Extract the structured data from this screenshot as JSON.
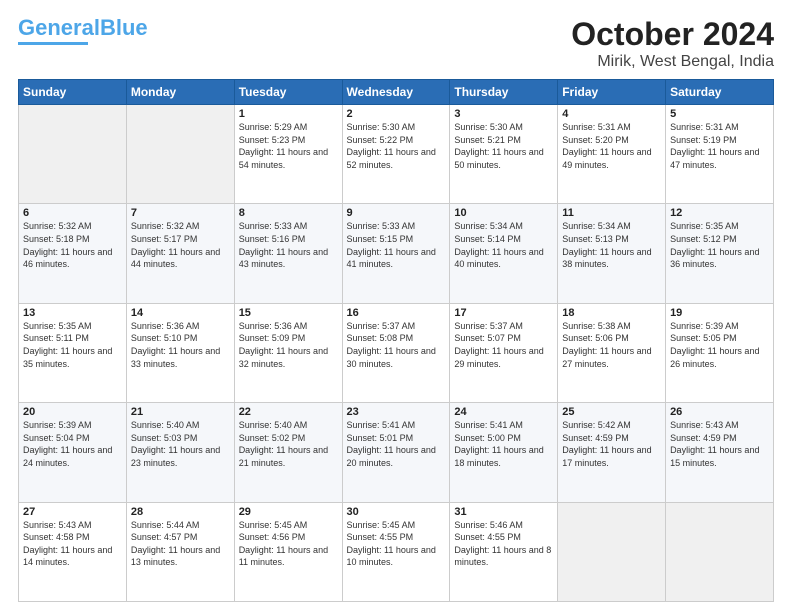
{
  "header": {
    "logo_line1": "General",
    "logo_line2": "Blue",
    "title": "October 2024",
    "subtitle": "Mirik, West Bengal, India"
  },
  "days_of_week": [
    "Sunday",
    "Monday",
    "Tuesday",
    "Wednesday",
    "Thursday",
    "Friday",
    "Saturday"
  ],
  "weeks": [
    [
      {
        "day": "",
        "empty": true
      },
      {
        "day": "",
        "empty": true
      },
      {
        "day": "1",
        "sunrise": "5:29 AM",
        "sunset": "5:23 PM",
        "daylight": "11 hours and 54 minutes."
      },
      {
        "day": "2",
        "sunrise": "5:30 AM",
        "sunset": "5:22 PM",
        "daylight": "11 hours and 52 minutes."
      },
      {
        "day": "3",
        "sunrise": "5:30 AM",
        "sunset": "5:21 PM",
        "daylight": "11 hours and 50 minutes."
      },
      {
        "day": "4",
        "sunrise": "5:31 AM",
        "sunset": "5:20 PM",
        "daylight": "11 hours and 49 minutes."
      },
      {
        "day": "5",
        "sunrise": "5:31 AM",
        "sunset": "5:19 PM",
        "daylight": "11 hours and 47 minutes."
      }
    ],
    [
      {
        "day": "6",
        "sunrise": "5:32 AM",
        "sunset": "5:18 PM",
        "daylight": "11 hours and 46 minutes."
      },
      {
        "day": "7",
        "sunrise": "5:32 AM",
        "sunset": "5:17 PM",
        "daylight": "11 hours and 44 minutes."
      },
      {
        "day": "8",
        "sunrise": "5:33 AM",
        "sunset": "5:16 PM",
        "daylight": "11 hours and 43 minutes."
      },
      {
        "day": "9",
        "sunrise": "5:33 AM",
        "sunset": "5:15 PM",
        "daylight": "11 hours and 41 minutes."
      },
      {
        "day": "10",
        "sunrise": "5:34 AM",
        "sunset": "5:14 PM",
        "daylight": "11 hours and 40 minutes."
      },
      {
        "day": "11",
        "sunrise": "5:34 AM",
        "sunset": "5:13 PM",
        "daylight": "11 hours and 38 minutes."
      },
      {
        "day": "12",
        "sunrise": "5:35 AM",
        "sunset": "5:12 PM",
        "daylight": "11 hours and 36 minutes."
      }
    ],
    [
      {
        "day": "13",
        "sunrise": "5:35 AM",
        "sunset": "5:11 PM",
        "daylight": "11 hours and 35 minutes."
      },
      {
        "day": "14",
        "sunrise": "5:36 AM",
        "sunset": "5:10 PM",
        "daylight": "11 hours and 33 minutes."
      },
      {
        "day": "15",
        "sunrise": "5:36 AM",
        "sunset": "5:09 PM",
        "daylight": "11 hours and 32 minutes."
      },
      {
        "day": "16",
        "sunrise": "5:37 AM",
        "sunset": "5:08 PM",
        "daylight": "11 hours and 30 minutes."
      },
      {
        "day": "17",
        "sunrise": "5:37 AM",
        "sunset": "5:07 PM",
        "daylight": "11 hours and 29 minutes."
      },
      {
        "day": "18",
        "sunrise": "5:38 AM",
        "sunset": "5:06 PM",
        "daylight": "11 hours and 27 minutes."
      },
      {
        "day": "19",
        "sunrise": "5:39 AM",
        "sunset": "5:05 PM",
        "daylight": "11 hours and 26 minutes."
      }
    ],
    [
      {
        "day": "20",
        "sunrise": "5:39 AM",
        "sunset": "5:04 PM",
        "daylight": "11 hours and 24 minutes."
      },
      {
        "day": "21",
        "sunrise": "5:40 AM",
        "sunset": "5:03 PM",
        "daylight": "11 hours and 23 minutes."
      },
      {
        "day": "22",
        "sunrise": "5:40 AM",
        "sunset": "5:02 PM",
        "daylight": "11 hours and 21 minutes."
      },
      {
        "day": "23",
        "sunrise": "5:41 AM",
        "sunset": "5:01 PM",
        "daylight": "11 hours and 20 minutes."
      },
      {
        "day": "24",
        "sunrise": "5:41 AM",
        "sunset": "5:00 PM",
        "daylight": "11 hours and 18 minutes."
      },
      {
        "day": "25",
        "sunrise": "5:42 AM",
        "sunset": "4:59 PM",
        "daylight": "11 hours and 17 minutes."
      },
      {
        "day": "26",
        "sunrise": "5:43 AM",
        "sunset": "4:59 PM",
        "daylight": "11 hours and 15 minutes."
      }
    ],
    [
      {
        "day": "27",
        "sunrise": "5:43 AM",
        "sunset": "4:58 PM",
        "daylight": "11 hours and 14 minutes."
      },
      {
        "day": "28",
        "sunrise": "5:44 AM",
        "sunset": "4:57 PM",
        "daylight": "11 hours and 13 minutes."
      },
      {
        "day": "29",
        "sunrise": "5:45 AM",
        "sunset": "4:56 PM",
        "daylight": "11 hours and 11 minutes."
      },
      {
        "day": "30",
        "sunrise": "5:45 AM",
        "sunset": "4:55 PM",
        "daylight": "11 hours and 10 minutes."
      },
      {
        "day": "31",
        "sunrise": "5:46 AM",
        "sunset": "4:55 PM",
        "daylight": "11 hours and 8 minutes."
      },
      {
        "day": "",
        "empty": true
      },
      {
        "day": "",
        "empty": true
      }
    ]
  ],
  "labels": {
    "sunrise": "Sunrise: ",
    "sunset": "Sunset: ",
    "daylight": "Daylight: "
  }
}
